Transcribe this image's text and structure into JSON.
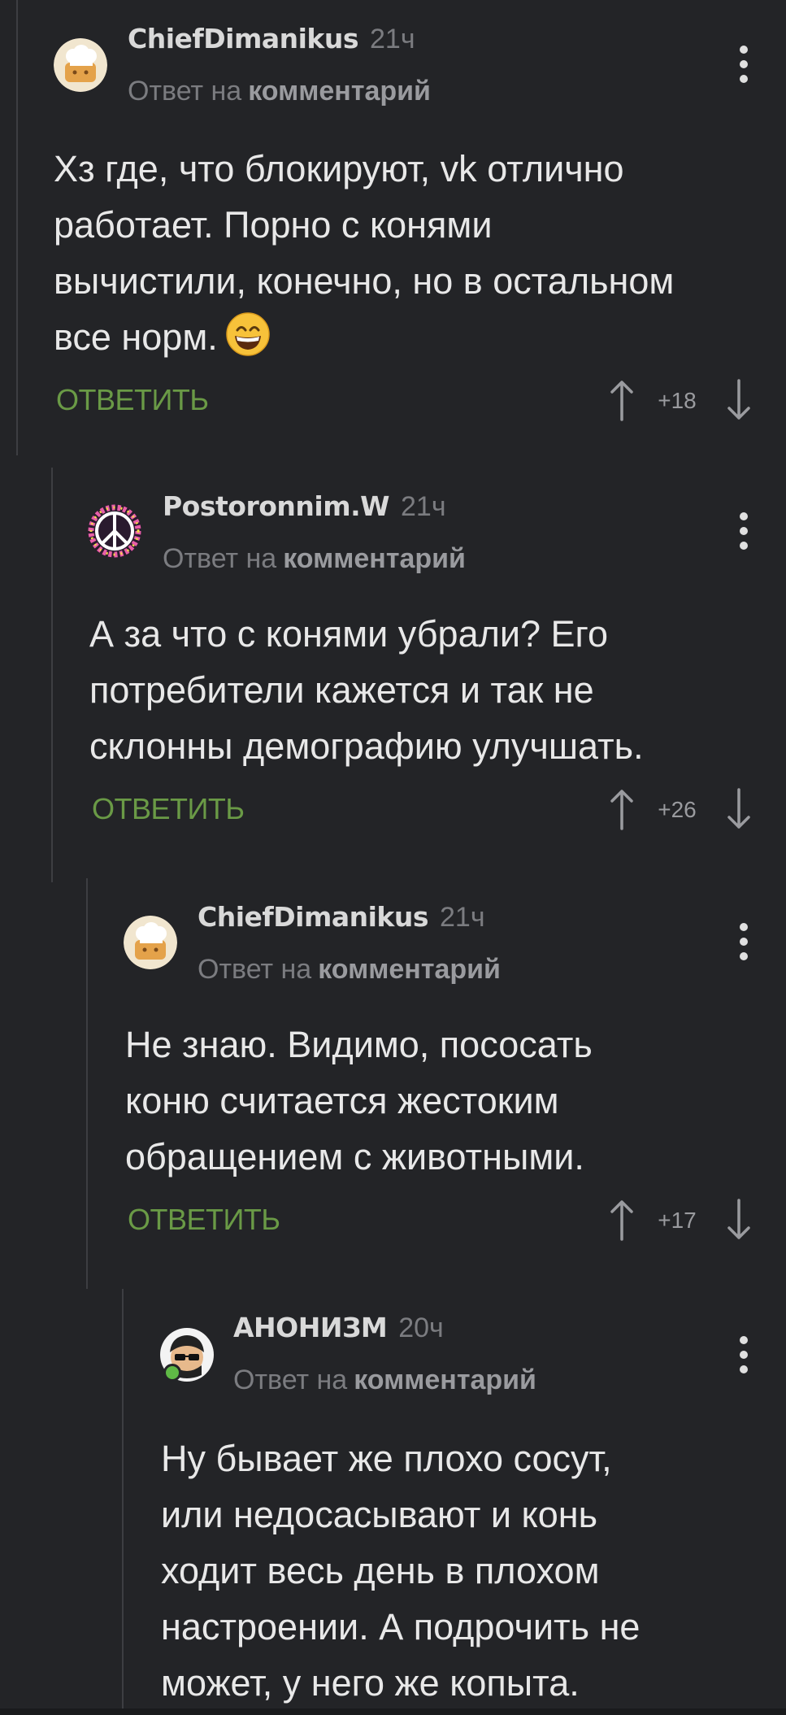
{
  "comments": [
    {
      "author": "ChiefDimanikus",
      "time": "21ч",
      "reply_prefix": "Ответ на",
      "reply_target": "комментарий",
      "text": "Хз где, что блокируют, vk отлично\nработает. Порно с конями\nвычистили, конечно, но в остальном\nвсе норм.",
      "emoji": "grinning-face-emoji",
      "reply_label": "ОТВЕТИТЬ",
      "score": "+18",
      "avatar_icon": "chef-hat-avatar-icon"
    },
    {
      "author": "Postoronnim.W",
      "time": "21ч",
      "reply_prefix": "Ответ на",
      "reply_target": "комментарий",
      "text": "А за что с конями убрали? Его\nпотребители кажется и так не\nсклонны демографию улучшать.",
      "reply_label": "ОТВЕТИТЬ",
      "score": "+26",
      "avatar_icon": "peace-sign-avatar-icon"
    },
    {
      "author": "ChiefDimanikus",
      "time": "21ч",
      "reply_prefix": "Ответ на",
      "reply_target": "комментарий",
      "text": "Не знаю. Видимо, пососать\nконю считается жестоким\nобращением с животными.",
      "reply_label": "ОТВЕТИТЬ",
      "score": "+17",
      "avatar_icon": "chef-hat-avatar-icon"
    },
    {
      "author": "АНОНИЗМ",
      "time": "20ч",
      "reply_prefix": "Ответ на",
      "reply_target": "комментарий",
      "text": "Ну бывает же плохо сосут,\nили недосасывают и конь\nходит весь день в плохом\nнастроении. А подрочить не\nможет, у него же копыта.",
      "avatar_icon": "anon-sunglasses-avatar-icon",
      "online": true
    }
  ],
  "colors": {
    "background": "#232427",
    "reply_button": "#6a9a46",
    "thread_line": "#3d3e42",
    "muted_text": "#7b7c80"
  }
}
